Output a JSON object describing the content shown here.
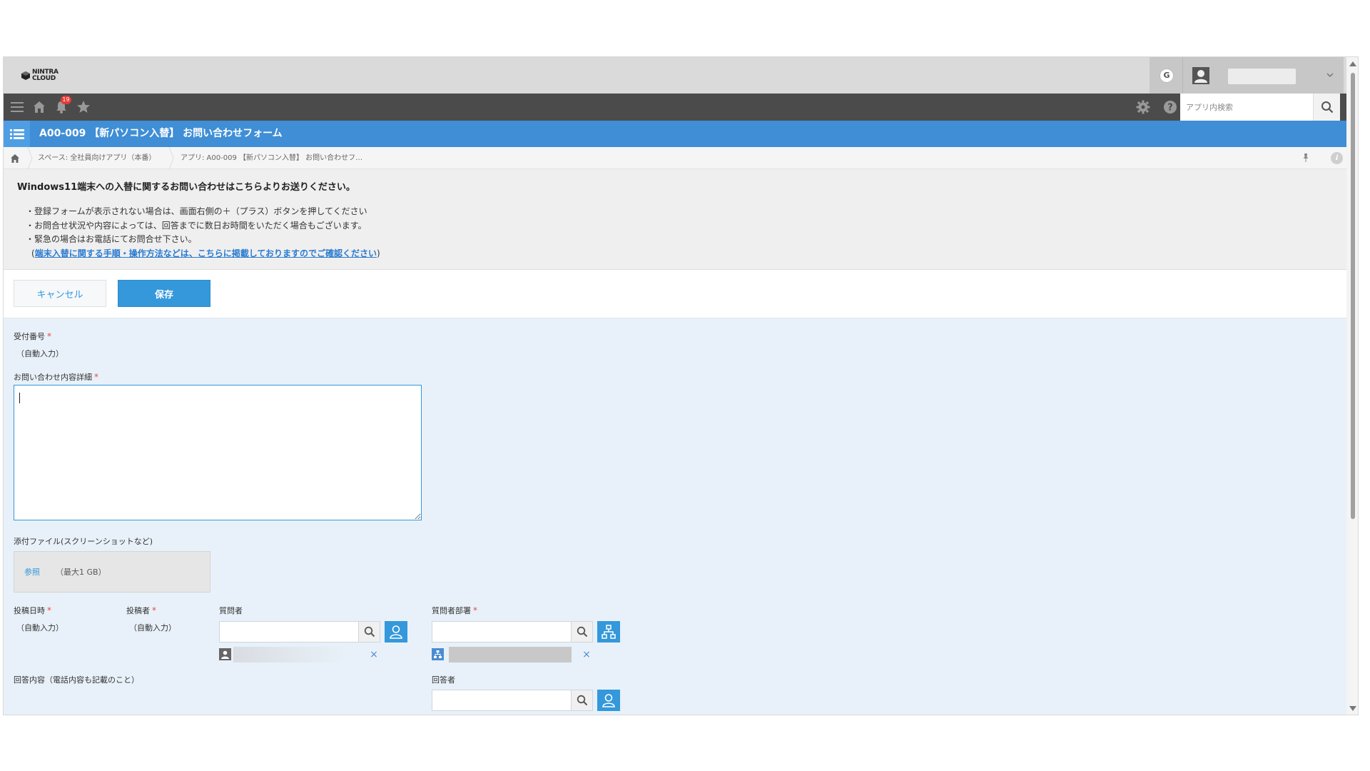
{
  "header": {
    "logo_text_line1": "NINTRA",
    "logo_text_line2": "CLOUD",
    "account_badge": "G"
  },
  "toolbar": {
    "notification_count": "19",
    "search_placeholder": "アプリ内検索"
  },
  "app": {
    "title": "A00-009 【新パソコン入替】 お問い合わせフォーム"
  },
  "breadcrumb": {
    "space": "スペース: 全社員向けアプリ（本番）",
    "app": "アプリ: A00-009 【新パソコン入替】 お問い合わせフ…"
  },
  "description": {
    "title": "Windows11端末への入替に関するお問い合わせはこちらよりお送りください。",
    "lines": [
      "・登録フォームが表示されない場合は、画面右側の＋（プラス）ボタンを押してください",
      "・お問合せ状況や内容によっては、回答までに数日お時間をいただく場合もございます。",
      "・緊急の場合はお電話にてお問合せ下さい。"
    ],
    "link_open": "(",
    "link_text": "端末入替に関する手順・操作方法などは、こちらに掲載しておりますのでご確認ください",
    "link_close": ")"
  },
  "actions": {
    "cancel_label": "キャンセル",
    "save_label": "保存"
  },
  "form": {
    "reception_no_label": "受付番号",
    "reception_no_value": "（自動入力）",
    "detail_label": "お問い合わせ内容詳細",
    "attachment_label": "添付ファイル(スクリーンショットなど)",
    "browse_label": "参照",
    "max_size_label": "（最大1 GB）",
    "posted_at_label": "投稿日時",
    "posted_at_value": "（自動入力）",
    "poster_label": "投稿者",
    "poster_value": "（自動入力）",
    "questioner_label": "質問者",
    "questioner_dept_label": "質問者部署",
    "answer_content_label": "回答内容（電話内容も記載のこと）",
    "answerer_label": "回答者",
    "required_mark": "*",
    "remove_mark": "×"
  },
  "colors": {
    "accent": "#3498db",
    "app_header": "#3f8ed6",
    "required": "#e74c3c",
    "form_bg": "#e8f1f9"
  }
}
